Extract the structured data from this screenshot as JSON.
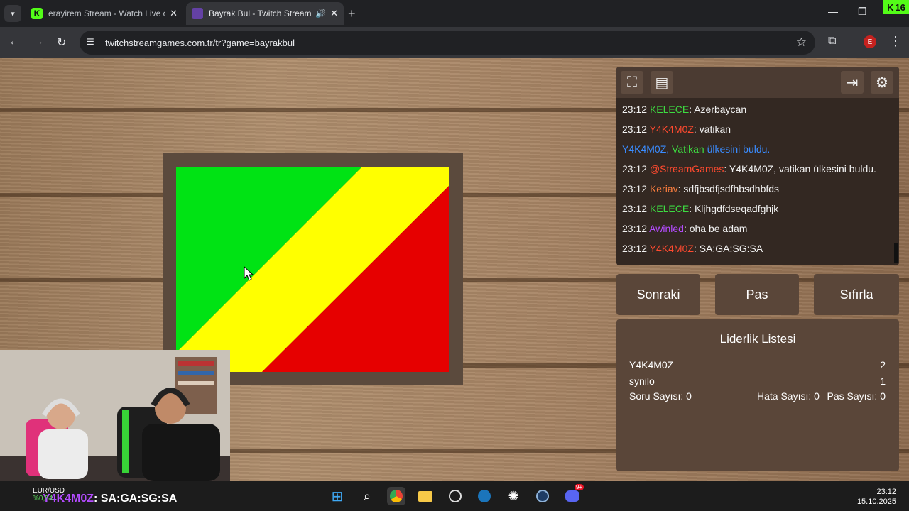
{
  "browser": {
    "tabs": [
      {
        "title": "erayirem Stream - Watch Live o",
        "favicon_color": "#53fc18",
        "favicon_glyph": "K"
      },
      {
        "title": "Bayrak Bul - Twitch Stream (",
        "favicon_color": "#6441a5",
        "favicon_glyph": "",
        "active": true
      }
    ],
    "url": "twitchstreamgames.com.tr/tr?game=bayrakbul",
    "profile_initial": "E",
    "corner_badge": "16",
    "icons": {
      "tab_search": "chevron-down-icon",
      "new_tab": "plus-icon",
      "minimize": "minimize-icon",
      "maximize": "restore-icon",
      "close": "close-icon",
      "back": "back-arrow-icon",
      "forward": "forward-arrow-icon",
      "reload": "reload-icon",
      "site_info": "tune-icon",
      "bookmark": "star-icon",
      "extensions": "puzzle-icon",
      "menu": "kebab-icon"
    }
  },
  "game": {
    "flag_colors": [
      "#00e314",
      "#ffff00",
      "#e60000"
    ],
    "chat": [
      {
        "time": "23:12",
        "user": "KELECE",
        "user_color": "#3ddb41",
        "text": "Azerbaycan"
      },
      {
        "time": "23:12",
        "user": "Y4K4M0Z",
        "user_color": "#ff4a2f",
        "text": "vatikan"
      },
      {
        "system": true,
        "parts": [
          {
            "text": "Y4K4M0Z,",
            "color": "#3a8cff"
          },
          {
            "text": " Vatikan",
            "color": "#3ddb41"
          },
          {
            "text": " ülkesini buldu.",
            "color": "#3a8cff"
          }
        ]
      },
      {
        "time": "23:12",
        "user": "@StreamGames",
        "user_color": "#ff4a2f",
        "text": "Y4K4M0Z, vatikan ülkesini buldu."
      },
      {
        "time": "23:12",
        "user": "Keriav",
        "user_color": "#ff7f3f",
        "text": "sdfjbsdfjsdfhbsdhbfds"
      },
      {
        "time": "23:12",
        "user": "KELECE",
        "user_color": "#3ddb41",
        "text": "Kljhgdfdseqadfghjk"
      },
      {
        "time": "23:12",
        "user": "Awinled",
        "user_color": "#b44cff",
        "text": "oha be adam"
      },
      {
        "time": "23:12",
        "user": "Y4K4M0Z",
        "user_color": "#ff4a2f",
        "text": "SA:GA:SG:SA"
      }
    ],
    "panel_icons": [
      "fullscreen-icon",
      "notes-icon",
      "logout-icon",
      "settings-gear-icon"
    ],
    "buttons": {
      "next": "Sonraki",
      "pass": "Pas",
      "reset": "Sıfırla"
    },
    "leaderboard": {
      "title": "Liderlik Listesi",
      "rows": [
        {
          "name": "Y4K4M0Z",
          "score": "2"
        },
        {
          "name": "synilo",
          "score": "1"
        }
      ],
      "stats": {
        "questions": "Soru Sayısı: 0",
        "errors": "Hata Sayısı: 0",
        "passes": "Pas Sayısı: 0"
      }
    }
  },
  "overlay": {
    "chat_user": "Y4K4M0Z",
    "chat_text": ": SA:GA:SG:SA",
    "forex_label": "EUR/USD",
    "forex_value": "%0,54"
  },
  "taskbar": {
    "icons": [
      "windows-start-icon",
      "search-icon",
      "chrome-icon",
      "file-explorer-icon",
      "obs-icon",
      "steam-alt-icon",
      "chatgpt-icon",
      "steam-icon",
      "discord-icon"
    ],
    "discord_badge": "9+",
    "time": "23:12",
    "date": "15.10.2025"
  }
}
